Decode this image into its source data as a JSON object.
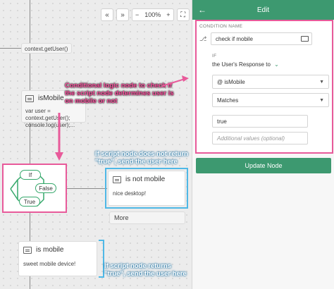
{
  "toolbar": {
    "collapse_label": "«",
    "expand_label": "»",
    "zoom_out_label": "−",
    "zoom_value": "100%",
    "zoom_in_label": "+",
    "fit_label": "⛶"
  },
  "canvas": {
    "top_node_text": "context.getUser()",
    "script_node": {
      "title": "isMobile",
      "code_line1": "var user = context.getUser();",
      "code_line2": "console.log(user);..."
    },
    "condition": {
      "if_label": "If",
      "false_label": "False",
      "true_label": "True"
    },
    "not_mobile_node": {
      "title": "is not mobile",
      "body": "nice desktop!"
    },
    "more_button": "More",
    "mobile_node": {
      "title": "is mobile",
      "body": "sweet mobile device!"
    }
  },
  "annotations": {
    "pink": "Conditional logic node to check if the script node determines user is on mobile or not",
    "blue_top": "If script node does not return \"true\", send the user here",
    "blue_bottom": "If script node returns \"true\", send the user here"
  },
  "panel": {
    "back_icon": "arrow-left-icon",
    "title": "Edit",
    "condition_name_label": "CONDITION NAME",
    "condition_name_value": "check if mobile",
    "if_label": "IF",
    "response_label": "the User's Response to",
    "response_select": "@ isMobile",
    "operator_select": "Matches",
    "value": "true",
    "additional_placeholder": "Additional values (optional)",
    "update_button": "Update Node"
  },
  "colors": {
    "accent_green": "#3d9970",
    "highlight_pink": "#e85a9a",
    "highlight_blue": "#4fb8e6"
  }
}
